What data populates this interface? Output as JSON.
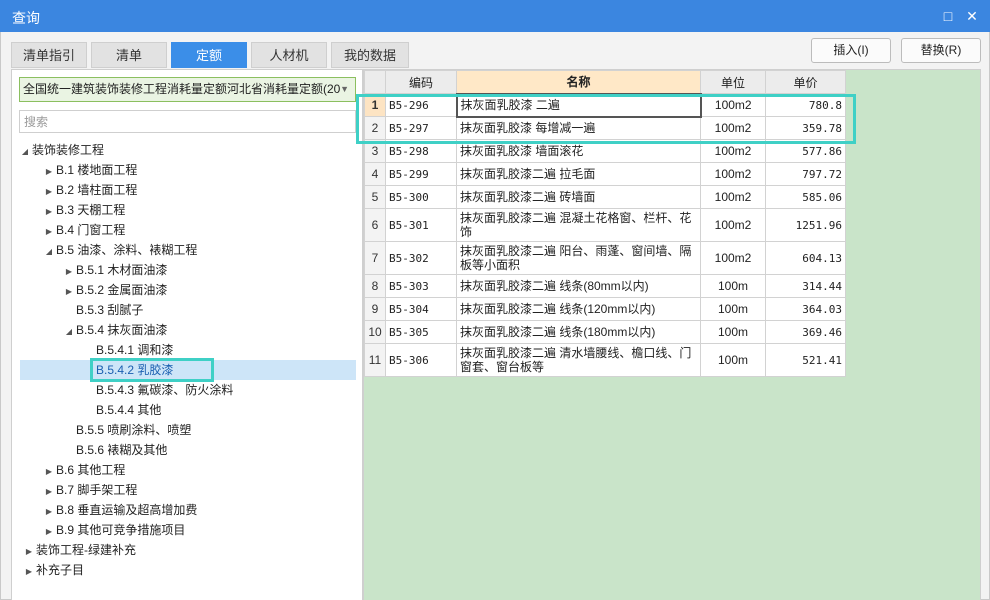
{
  "window": {
    "title": "查询",
    "restore_icon": "restore-icon",
    "close_icon": "close-icon"
  },
  "tabs": [
    {
      "label": "清单指引",
      "active": false
    },
    {
      "label": "清单",
      "active": false
    },
    {
      "label": "定额",
      "active": true
    },
    {
      "label": "人材机",
      "active": false
    },
    {
      "label": "我的数据",
      "active": false
    }
  ],
  "actions": {
    "insert_label": "插入(I)",
    "replace_label": "替换(R)"
  },
  "library": {
    "selected": "全国统一建筑装饰装修工程消耗量定额河北省消耗量定额(20"
  },
  "search": {
    "placeholder": "搜索",
    "value": ""
  },
  "tree": [
    {
      "label": "装饰装修工程",
      "expanded": true
    },
    {
      "label": "B.1 楼地面工程",
      "expanded": false
    },
    {
      "label": "B.2 墙柱面工程",
      "expanded": false
    },
    {
      "label": "B.3 天棚工程",
      "expanded": false
    },
    {
      "label": "B.4 门窗工程",
      "expanded": false
    },
    {
      "label": "B.5 油漆、涂料、裱糊工程",
      "expanded": true
    },
    {
      "label": "B.5.1 木材面油漆",
      "expanded": false
    },
    {
      "label": "B.5.2 金属面油漆",
      "expanded": false
    },
    {
      "label": "B.5.3 刮腻子"
    },
    {
      "label": "B.5.4 抹灰面油漆",
      "expanded": true
    },
    {
      "label": "B.5.4.1 调和漆"
    },
    {
      "label": "B.5.4.2 乳胶漆",
      "selected": true
    },
    {
      "label": "B.5.4.3 氟碳漆、防火涂料"
    },
    {
      "label": "B.5.4.4 其他"
    },
    {
      "label": "B.5.5 喷刷涂料、喷塑"
    },
    {
      "label": "B.5.6 裱糊及其他"
    },
    {
      "label": "B.6 其他工程",
      "expanded": false
    },
    {
      "label": "B.7 脚手架工程",
      "expanded": false
    },
    {
      "label": "B.8 垂直运输及超高增加费",
      "expanded": false
    },
    {
      "label": "B.9 其他可竞争措施项目",
      "expanded": false
    },
    {
      "label": "装饰工程-绿建补充",
      "expanded": false
    },
    {
      "label": "补充子目",
      "expanded": false
    }
  ],
  "grid": {
    "headers": {
      "code": "编码",
      "name": "名称",
      "unit": "单位",
      "price": "单价"
    },
    "rows": [
      {
        "no": "1",
        "code": "B5-296",
        "name": "抹灰面乳胶漆 二遍",
        "unit": "100m2",
        "price": "780.8"
      },
      {
        "no": "2",
        "code": "B5-297",
        "name": "抹灰面乳胶漆 每增减一遍",
        "unit": "100m2",
        "price": "359.78"
      },
      {
        "no": "3",
        "code": "B5-298",
        "name": "抹灰面乳胶漆 墙面滚花",
        "unit": "100m2",
        "price": "577.86"
      },
      {
        "no": "4",
        "code": "B5-299",
        "name": "抹灰面乳胶漆二遍 拉毛面",
        "unit": "100m2",
        "price": "797.72"
      },
      {
        "no": "5",
        "code": "B5-300",
        "name": "抹灰面乳胶漆二遍 砖墙面",
        "unit": "100m2",
        "price": "585.06"
      },
      {
        "no": "6",
        "code": "B5-301",
        "name": "抹灰面乳胶漆二遍 混凝土花格窗、栏杆、花饰",
        "unit": "100m2",
        "price": "1251.96"
      },
      {
        "no": "7",
        "code": "B5-302",
        "name": "抹灰面乳胶漆二遍 阳台、雨蓬、窗间墙、隔板等小面积",
        "unit": "100m2",
        "price": "604.13"
      },
      {
        "no": "8",
        "code": "B5-303",
        "name": "抹灰面乳胶漆二遍 线条(80mm以内)",
        "unit": "100m",
        "price": "314.44"
      },
      {
        "no": "9",
        "code": "B5-304",
        "name": "抹灰面乳胶漆二遍 线条(120mm以内)",
        "unit": "100m",
        "price": "364.03"
      },
      {
        "no": "10",
        "code": "B5-305",
        "name": "抹灰面乳胶漆二遍 线条(180mm以内)",
        "unit": "100m",
        "price": "369.46"
      },
      {
        "no": "11",
        "code": "B5-306",
        "name": "抹灰面乳胶漆二遍 清水墙腰线、檐口线、门窗套、窗台板等",
        "unit": "100m",
        "price": "521.41"
      }
    ]
  },
  "colors": {
    "accent": "#3b86e0",
    "highlight": "#3fd0c6",
    "grid_bg": "#c9e4c9"
  }
}
